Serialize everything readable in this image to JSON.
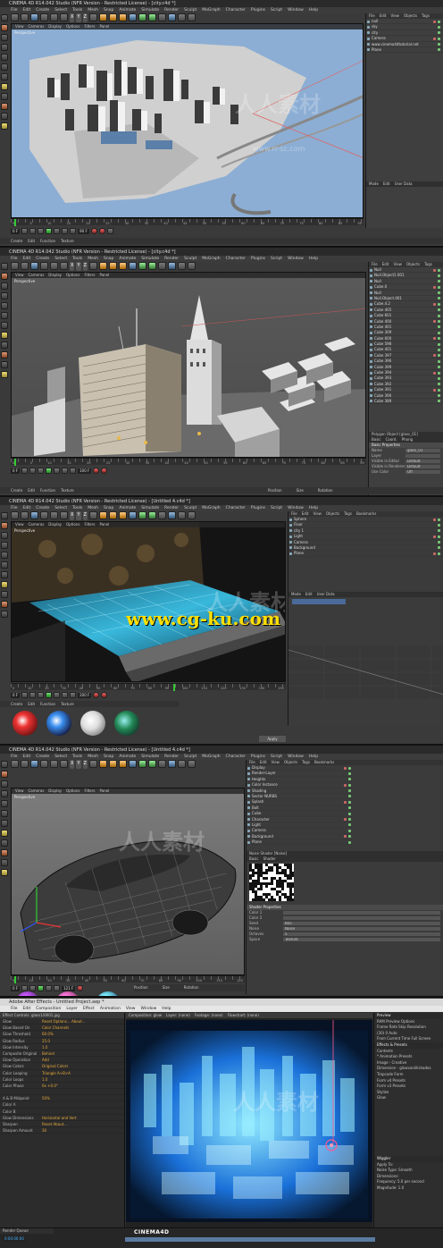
{
  "panel1": {
    "title": "CINEMA 4D R14.042 Studio (NFR Version - Restricted License) - [city.c4d *]",
    "menu": [
      "File",
      "Edit",
      "Create",
      "Select",
      "Tools",
      "Mesh",
      "Snap",
      "Animate",
      "Simulate",
      "Render",
      "Sculpt",
      "MoGraph",
      "Character",
      "Plugins",
      "Script",
      "Window",
      "Help"
    ],
    "vp_menu": [
      "View",
      "Cameras",
      "Display",
      "Options",
      "Filters",
      "Panel"
    ],
    "vp_label": "Perspective",
    "obj_tabs": [
      "File",
      "Edit",
      "View",
      "Objects",
      "Tags"
    ],
    "objects": [
      "null",
      "sky",
      "city",
      "Camera",
      "www.cinema4dtutorial.net",
      "Plane"
    ],
    "attr_tabs": [
      "Mode",
      "Edit",
      "User Data"
    ],
    "timeline_nums": [
      "0",
      "5",
      "10",
      "15",
      "20",
      "25",
      "30",
      "35",
      "40",
      "45",
      "50",
      "55",
      "60",
      "65",
      "70",
      "75",
      "80",
      "85",
      "90"
    ],
    "frame_field": "0 F",
    "end_field": "90 F",
    "mat_menu": [
      "Create",
      "Edit",
      "Function",
      "Texture"
    ],
    "watermark_sub": "www.rr-sc.com",
    "watermark_main": "人人素材"
  },
  "panel2": {
    "title": "CINEMA 4D R14.042 Studio (NFR Version - Restricted License) - [city.c4d *]",
    "menu": [
      "File",
      "Edit",
      "Create",
      "Select",
      "Tools",
      "Mesh",
      "Snap",
      "Animate",
      "Simulate",
      "Render",
      "Sculpt",
      "MoGraph",
      "Character",
      "Plugins",
      "Script",
      "Window",
      "Help"
    ],
    "vp_menu": [
      "View",
      "Cameras",
      "Display",
      "Options",
      "Filters",
      "Panel"
    ],
    "vp_label": "Perspective",
    "obj_tabs": [
      "File",
      "Edit",
      "View",
      "Objects",
      "Tags"
    ],
    "objects": [
      "Null",
      "Null.Object1.001",
      "Null",
      "Cube.0",
      "Null",
      "Null.Object.001",
      "Cube.4.2",
      "Cube 405",
      "Cube 601",
      "Cube 400",
      "Cube 401",
      "Cube 309",
      "Cube 600",
      "Cube 598",
      "Cube 401",
      "Cube 397",
      "Cube 396",
      "Cube 399",
      "Cube 394",
      "Cube 393",
      "Cube 392",
      "Cube 391",
      "Cube 390",
      "Cube 389"
    ],
    "attr_title": "Polygon Object [glass_01]",
    "attr_tabs": [
      "Basic",
      "Coord.",
      "Phong"
    ],
    "attr_section": "Basic Properties",
    "attrs": [
      {
        "k": "Name",
        "v": "glass_01"
      },
      {
        "k": "Layer",
        "v": ""
      },
      {
        "k": "Visible in Editor",
        "v": "Default"
      },
      {
        "k": "Visible in Renderer",
        "v": "Default"
      },
      {
        "k": "Use Color",
        "v": "Off"
      }
    ],
    "timeline_nums": [
      "0",
      "5",
      "10",
      "15",
      "20",
      "25",
      "30",
      "35",
      "40",
      "45",
      "50",
      "55",
      "60",
      "65",
      "70",
      "75",
      "80",
      "85",
      "90"
    ],
    "frame_field": "0 F",
    "end_field": "100 F",
    "mat_menu": [
      "Create",
      "Edit",
      "Function",
      "Texture"
    ],
    "coord_labels": [
      "Position",
      "Size",
      "Rotation"
    ]
  },
  "panel3": {
    "title": "CINEMA 4D R14.042 Studio (NFR Version - Restricted License) - [Untitled 4.c4d *]",
    "menu": [
      "File",
      "Edit",
      "Create",
      "Select",
      "Tools",
      "Mesh",
      "Snap",
      "Animate",
      "Simulate",
      "Render",
      "Sculpt",
      "MoGraph",
      "Character",
      "Plugins",
      "Script",
      "Window",
      "Help"
    ],
    "vp_menu": [
      "View",
      "Cameras",
      "Display",
      "Options",
      "Filters",
      "Panel"
    ],
    "vp_label": "Perspective",
    "obj_tabs": [
      "File",
      "Edit",
      "View",
      "Objects",
      "Tags",
      "Bookmarks"
    ],
    "objects": [
      "Sphere",
      "Floor",
      "city 1",
      "Light",
      "Camera",
      "Background",
      "Plane"
    ],
    "attr_tabs": [
      "Mode",
      "Edit",
      "User Data"
    ],
    "timeline_nums": [
      "0",
      "10",
      "20",
      "30",
      "40",
      "50",
      "60",
      "70",
      "80",
      "90",
      "100",
      "110",
      "120",
      "130",
      "140",
      "150"
    ],
    "frame_field": "0 F",
    "end_field": "200 F",
    "mat_menu": [
      "Create",
      "Edit",
      "Function",
      "Texture"
    ],
    "cgku": "www.cg-ku.com",
    "watermark_main": "人人素材",
    "apply_label": "Apply"
  },
  "panel4": {
    "title": "CINEMA 4D R14.042 Studio (NFR Version - Restricted License) - [Untitled 4.c4d *]",
    "menu": [
      "File",
      "Edit",
      "Create",
      "Select",
      "Tools",
      "Mesh",
      "Snap",
      "Animate",
      "Simulate",
      "Render",
      "Sculpt",
      "MoGraph",
      "Character",
      "Plugins",
      "Script",
      "Window",
      "Help"
    ],
    "vp_menu": [
      "View",
      "Cameras",
      "Display",
      "Options",
      "Filters",
      "Panel"
    ],
    "vp_label": "Perspective",
    "obj_tabs": [
      "File",
      "Edit",
      "View",
      "Objects",
      "Tags",
      "Bookmarks"
    ],
    "objects": [
      "Display",
      "Render-Layer",
      "Heights",
      "Color Instance",
      "Shading",
      "Sector NURBS",
      "Splash",
      "Bolt",
      "Cube",
      "Character",
      "Light",
      "Camera",
      "Background",
      "Plane"
    ],
    "shader_title": "Noise Shader [Noise]",
    "shader_tabs": [
      "Basic",
      "Shader"
    ],
    "shader_section": "Shader Properties",
    "attrs": [
      {
        "k": "Color 1",
        "v": ""
      },
      {
        "k": "Color 2",
        "v": ""
      },
      {
        "k": "Seed",
        "v": "665"
      },
      {
        "k": "Noise",
        "v": "Noise"
      },
      {
        "k": "Octaves",
        "v": "5"
      },
      {
        "k": "Space",
        "v": "Texture"
      }
    ],
    "coord_labels": [
      "Position",
      "Size",
      "Rotation"
    ],
    "timeline_nums": [
      "0",
      "10",
      "20",
      "30",
      "40",
      "50",
      "60",
      "70",
      "80",
      "90",
      "100",
      "110",
      "120"
    ],
    "frame_field": "0 F",
    "end_field": "121 F",
    "watermark_main": "人人素材"
  },
  "panel5": {
    "title": "Adobe After Effects - Untitled Project.aep *",
    "menu": [
      "File",
      "Edit",
      "Composition",
      "Layer",
      "Effect",
      "Animation",
      "View",
      "Window",
      "Help"
    ],
    "effect_header": "Effect Controls: glass1/0001.jpg",
    "effects": [
      {
        "k": "Glow",
        "v": "Reset  Options...  About..."
      },
      {
        "k": "Glow Based On",
        "v": "Color Channels"
      },
      {
        "k": "Glow Threshold",
        "v": "60.0%"
      },
      {
        "k": "Glow Radius",
        "v": "25.0"
      },
      {
        "k": "Glow Intensity",
        "v": "1.0"
      },
      {
        "k": "Composite Original",
        "v": "Behind"
      },
      {
        "k": "Glow Operation",
        "v": "Add"
      },
      {
        "k": "Glow Colors",
        "v": "Original Colors"
      },
      {
        "k": "Color Looping",
        "v": "Triangle A>B>A"
      },
      {
        "k": "Color Loops",
        "v": "1.0"
      },
      {
        "k": "Color Phase",
        "v": "0x +0.0°"
      },
      {
        "k": "",
        "v": ""
      },
      {
        "k": "A & B Midpoint",
        "v": "50%"
      },
      {
        "k": "Color A",
        "v": ""
      },
      {
        "k": "Color B",
        "v": ""
      },
      {
        "k": "Glow Dimensions",
        "v": "Horizontal and Vert"
      },
      {
        "k": "Sharpen",
        "v": "Reset  About..."
      },
      {
        "k": "Sharpen Amount",
        "v": "30"
      }
    ],
    "comp_tabs": [
      "Composition: glow",
      "Layer: (none)",
      "Footage: (none)",
      "Flowchart: (none)"
    ],
    "right_panel": [
      {
        "t": "Preview",
        "h": true
      },
      {
        "t": "RAM Preview Options",
        "h": false
      },
      {
        "t": "Frame Rate   Skip   Resolution",
        "h": false
      },
      {
        "t": "(30)   0   Auto",
        "h": false
      },
      {
        "t": "From Current Time   Full Screen",
        "h": false
      },
      {
        "t": "Effects & Presets",
        "h": true
      },
      {
        "t": "Contents",
        "h": false
      },
      {
        "t": "* Animation Presets",
        "h": false
      },
      {
        "t": "Image - Creative",
        "h": false
      },
      {
        "t": "Dimension - glowvanillishades",
        "h": false
      },
      {
        "t": "Trapcode Form",
        "h": false
      },
      {
        "t": "Form v4 Presets",
        "h": false
      },
      {
        "t": "Form v3 Presets",
        "h": false
      },
      {
        "t": "Stylize",
        "h": false
      },
      {
        "t": "Glow",
        "h": false
      }
    ],
    "wiggler": [
      {
        "t": "Wiggler",
        "h": true
      },
      {
        "t": "Apply To:",
        "h": false
      },
      {
        "t": "Noise Type: Smooth",
        "h": false
      },
      {
        "t": "Dimensions:",
        "h": false
      },
      {
        "t": "Frequency: 5.0  per second",
        "h": false
      },
      {
        "t": "Magnitude: 1.0",
        "h": false
      }
    ],
    "timeline_label": "Render Queue",
    "time_field": "0:00:00:00",
    "watermark_main": "人人素材",
    "logo": "CINEMA4D"
  },
  "colors": {
    "ui_bg": "#3a3a3a",
    "title_bg": "#2a2a2a",
    "sky_blue": "#8fb0d8",
    "grey_city": "#c7c7c7",
    "glow_cyan": "#3fd5ff",
    "accent_yellow": "#ffe000",
    "ae_value": "#e8a93b"
  }
}
